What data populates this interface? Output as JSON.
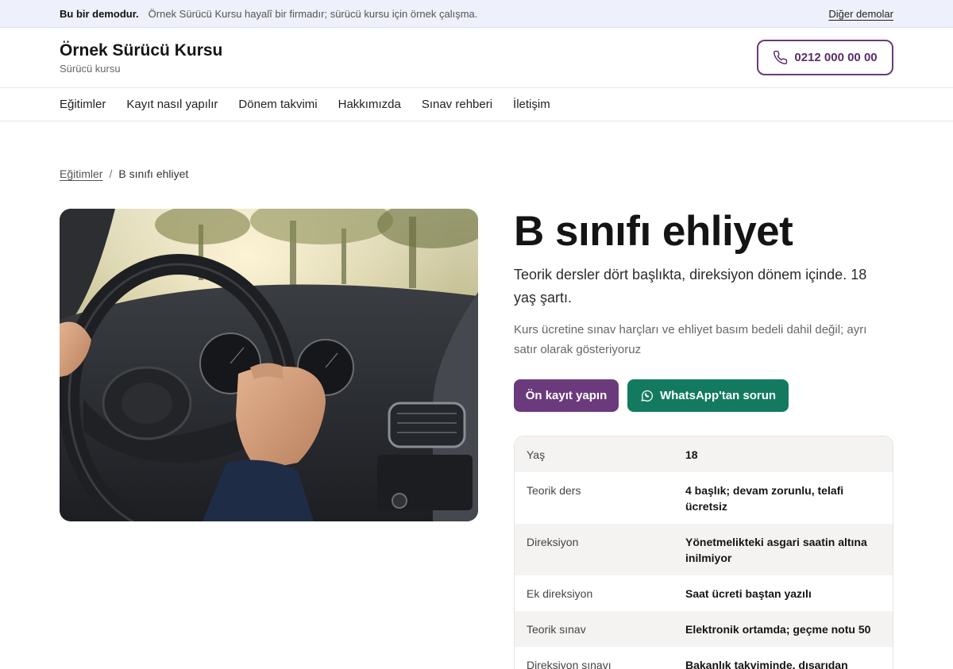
{
  "demo_bar": {
    "strong": "Bu bir demodur.",
    "text": "Örnek Sürücü Kursu hayalî bir firmadır; sürücü kursu için örnek çalışma.",
    "link": "Diğer demolar"
  },
  "header": {
    "brand_name": "Örnek Sürücü Kursu",
    "brand_tag": "Sürücü kursu",
    "phone": "0212 000 00 00"
  },
  "nav": {
    "items": [
      "Eğitimler",
      "Kayıt nasıl yapılır",
      "Dönem takvimi",
      "Hakkımızda",
      "Sınav rehberi",
      "İletişim"
    ]
  },
  "breadcrumb": {
    "parent": "Eğitimler",
    "separator": "/",
    "current": "B sınıfı ehliyet"
  },
  "page": {
    "title": "B sınıfı ehliyet",
    "lead": "Teorik dersler dört başlıkta, direksiyon dönem içinde. 18 yaş şartı.",
    "note": "Kurs ücretine sınav harçları ve ehliyet basım bedeli dahil değil; ayrı satır olarak gösteriyoruz",
    "primary_button": "Ön kayıt yapın",
    "whatsapp_button": "WhatsApp'tan sorun"
  },
  "details": [
    {
      "label": "Yaş",
      "value": "18"
    },
    {
      "label": "Teorik ders",
      "value": "4 başlık; devam zorunlu, telafi ücretsiz"
    },
    {
      "label": "Direksiyon",
      "value": "Yönetmelikteki asgari saatin altına inilmiyor"
    },
    {
      "label": "Ek direksiyon",
      "value": "Saat ücreti baştan yazılı"
    },
    {
      "label": "Teorik sınav",
      "value": "Elektronik ortamda; geçme notu 50"
    },
    {
      "label": "Direksiyon sınavı",
      "value": "Bakanlık takviminde, dışarıdan komisyonla"
    }
  ],
  "colors": {
    "brand_purple": "#6b3a7d",
    "whatsapp_green": "#137a5f",
    "demo_bar_bg": "#eef0fb"
  }
}
